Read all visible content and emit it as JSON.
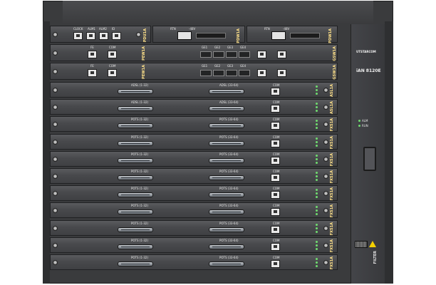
{
  "brand": {
    "logo_text": "UTSTARCOM",
    "model": "iAN 8120E"
  },
  "control_panel": {
    "alarm_label": "ALM",
    "run_label": "RUN",
    "filter_label": "FILTER"
  },
  "top_power": [
    {
      "side": "PDU1A",
      "ports": [
        "CLOCK",
        "ALM1",
        "ALM2",
        "ID"
      ]
    },
    {
      "side": "PDW1A",
      "input_label": "RTN",
      "volt_label": "-48V"
    },
    {
      "side": "PDW1A",
      "input_label": "RTN",
      "volt_label": "-48V"
    }
  ],
  "switch_cards": [
    {
      "side": "PEW1A",
      "fe_label": "FE",
      "com_label": "COM",
      "ge_ports": [
        "GE1",
        "GE2",
        "GE3",
        "GE4"
      ],
      "right_side": "GSW1A"
    },
    {
      "side": "PEW1A",
      "fe_label": "FE",
      "com_label": "COM",
      "ge_ports": [
        "GE1",
        "GE2",
        "GE3",
        "GE4"
      ],
      "right_side": "GSW1A"
    }
  ],
  "line_cards": [
    {
      "left": "ADSL (1-32)",
      "right": "ADSL (33-64)",
      "com": "COM",
      "side": "ASL1A"
    },
    {
      "left": "ADSL (1-32)",
      "right": "ADSL (33-64)",
      "com": "COM",
      "side": "ASL1A"
    },
    {
      "left": "POTS (1-32)",
      "right": "POTS (33-64)",
      "com": "COM",
      "side": "FXS1A"
    },
    {
      "left": "POTS (1-32)",
      "right": "POTS (33-64)",
      "com": "COM",
      "side": "FXS1A"
    },
    {
      "left": "POTS (1-32)",
      "right": "POTS (33-64)",
      "com": "COM",
      "side": "FXS1A"
    },
    {
      "left": "POTS (1-32)",
      "right": "POTS (33-64)",
      "com": "COM",
      "side": "FXS1A"
    },
    {
      "left": "POTS (1-32)",
      "right": "POTS (33-64)",
      "com": "COM",
      "side": "FXS1A"
    },
    {
      "left": "POTS (1-32)",
      "right": "POTS (33-64)",
      "com": "COM",
      "side": "FXS1A"
    },
    {
      "left": "POTS (1-32)",
      "right": "POTS (33-64)",
      "com": "COM",
      "side": "FXS1A"
    },
    {
      "left": "POTS (1-32)",
      "right": "POTS (33-64)",
      "com": "COM",
      "side": "FXS1A"
    },
    {
      "left": "POTS (1-32)",
      "right": "POTS (33-64)",
      "com": "COM",
      "side": "FXS1A"
    }
  ]
}
